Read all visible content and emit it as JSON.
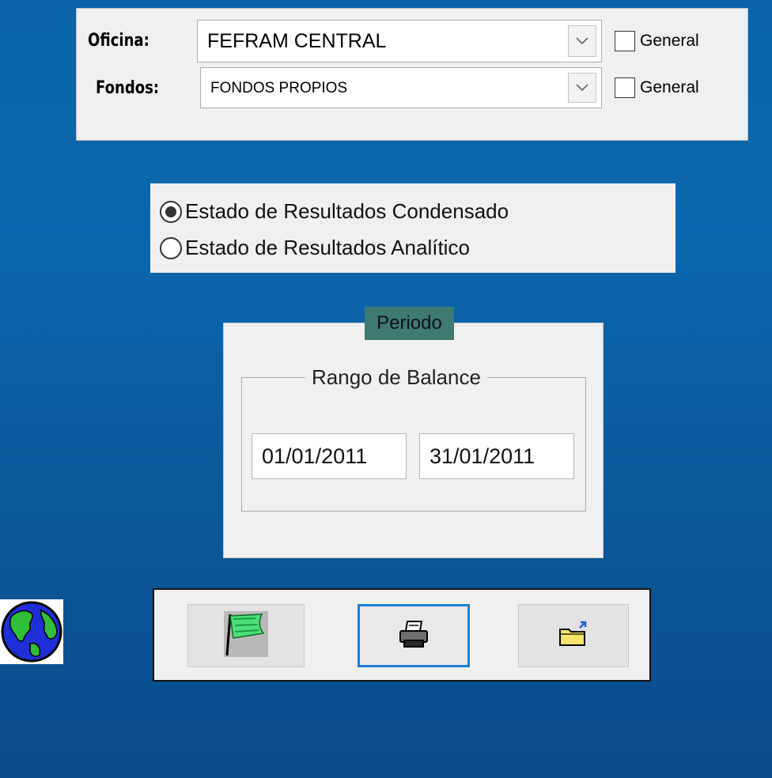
{
  "filters": {
    "oficina": {
      "label": "Oficina:",
      "value": "FEFRAM CENTRAL",
      "general_label": "General",
      "general_checked": false
    },
    "fondos": {
      "label": "Fondos:",
      "value": "FONDOS PROPIOS",
      "general_label": "General",
      "general_checked": false
    }
  },
  "report_type": {
    "options": [
      {
        "label": "Estado de Resultados Condensado",
        "selected": true
      },
      {
        "label": "Estado de Resultados Analítico",
        "selected": false
      }
    ]
  },
  "period": {
    "title": "Periodo",
    "range_label": "Rango de Balance",
    "date_from": "01/01/2011",
    "date_to": "31/01/2011"
  },
  "toolbar": {
    "buttons": [
      {
        "icon": "green-flag-icon",
        "focused": false
      },
      {
        "icon": "printer-icon",
        "focused": true
      },
      {
        "icon": "open-folder-icon",
        "focused": false
      }
    ]
  },
  "colors": {
    "background": "#0b63a8",
    "panel": "#f0f0f0",
    "period_title_bg": "#3f7a72",
    "focus_border": "#1a7fd4"
  }
}
